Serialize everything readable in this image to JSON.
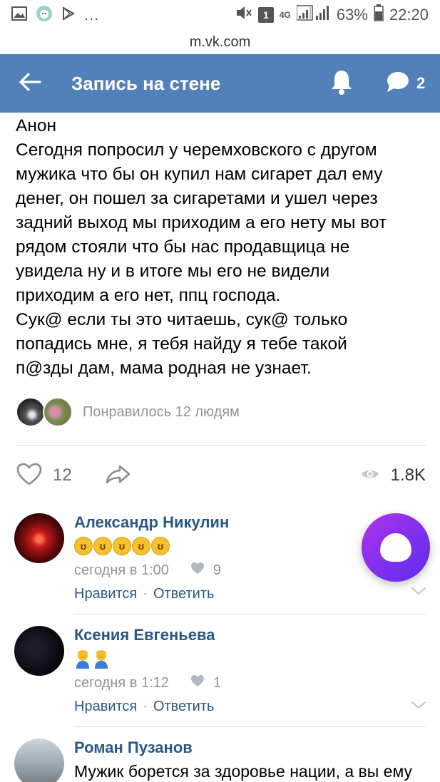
{
  "status_bar": {
    "more": "...",
    "sim": "1",
    "network": "4G",
    "battery": "63%",
    "time": "22:20"
  },
  "url_bar": {
    "url": "m.vk.com"
  },
  "header": {
    "title": "Запись на стене",
    "comments_count": "2"
  },
  "post": {
    "text": "Анон\nСегодня попросил у черемховского с другом\nмужика что бы он купил нам сигарет дал ему\nденег, он пошел за сигаретами и ушел через\nзадний выход мы приходим а его нету мы вот\nрядом стояли что бы нас продавщица не\nувидела ну и в итоге мы его не видели\nприходим а его нет, ппц господа.\nСук@ если ты это читаешь, сук@ только\nпопадись мне, я тебя найду я тебе такой\nп@зды дам, мама родная не узнает.",
    "likers_text": "Понравилось 12 людям",
    "like_count": "12",
    "views": "1.8K"
  },
  "comments": [
    {
      "author": "Александр Никулин",
      "text": "🤣🤣🤣🤣🤣",
      "time": "сегодня в 1:00",
      "likes": "9",
      "like_label": "Нравится",
      "reply_label": "Ответить"
    },
    {
      "author": "Ксения Евгеньева",
      "text": "🤦🤦",
      "time": "сегодня в 1:12",
      "likes": "1",
      "like_label": "Нравится",
      "reply_label": "Ответить"
    },
    {
      "author": "Роман Пузанов",
      "text": "Мужик борется за здоровье нации, а вы ему"
    }
  ],
  "colors": {
    "header_bg": "#5181b8",
    "link": "#2a5885",
    "muted": "#939393",
    "alice_gradient_start": "#b033e8",
    "alice_gradient_end": "#5f2fe6"
  }
}
